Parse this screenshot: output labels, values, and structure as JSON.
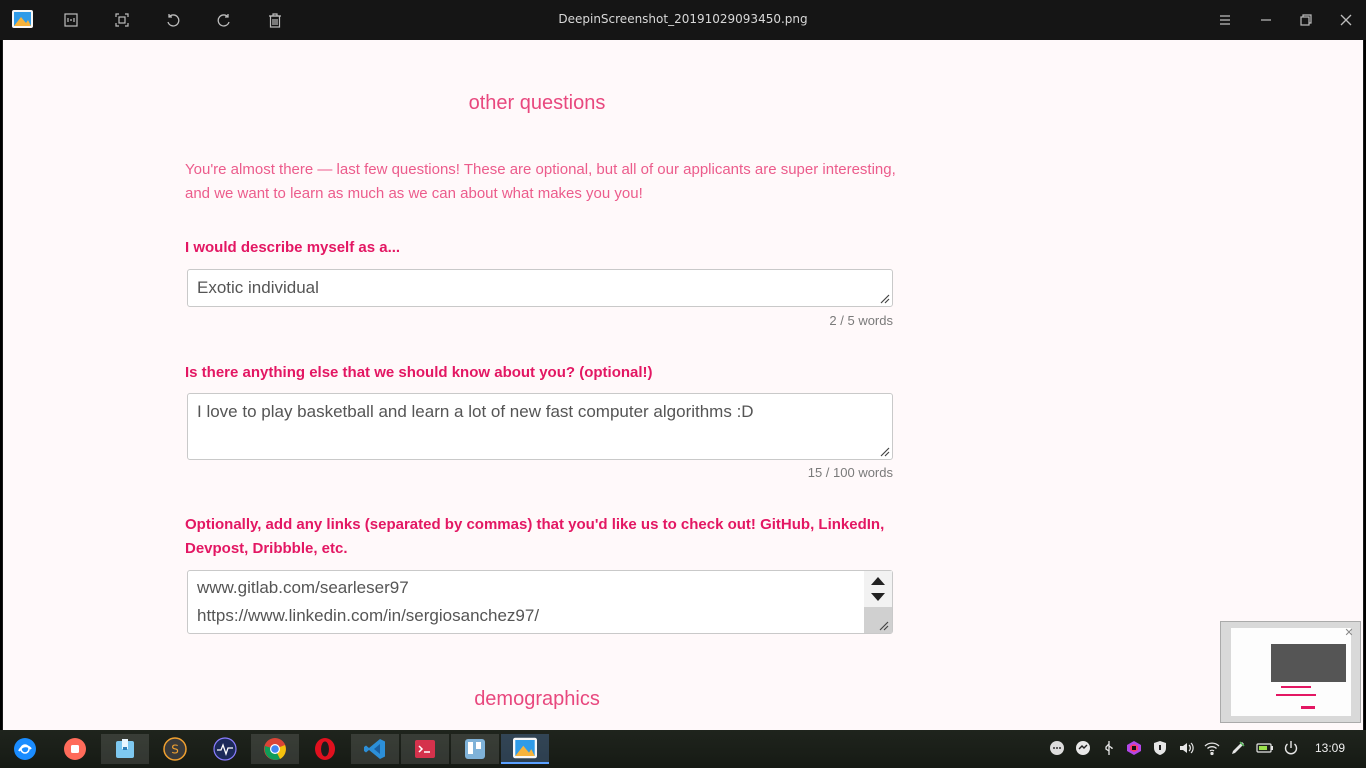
{
  "window": {
    "title": "DeepinScreenshot_20191029093450.png"
  },
  "form": {
    "section_title": "other questions",
    "intro": "You're almost there — last few questions! These are optional, but all of our applicants are super interesting, and we want to learn as much as we can about what makes you you!",
    "q1": {
      "label": "I would describe myself as a...",
      "value": "Exotic individual",
      "count": "2 / 5 words"
    },
    "q2": {
      "label": "Is there anything else that we should know about you? (optional!)",
      "value": "I love to play basketball and learn a lot of new fast computer algorithms :D",
      "count": "15 / 100 words"
    },
    "q3": {
      "label": "Optionally, add any links (separated by commas) that you'd like us to check out! GitHub, LinkedIn, Devpost, Dribbble, etc.",
      "line1": "www.gitlab.com/searleser97",
      "line2": "https://www.linkedin.com/in/sergiosanchez97/"
    },
    "next_section_title": "demographics"
  },
  "taskbar": {
    "apps": [
      "deepin-launcher",
      "screen-recorder",
      "file-manager",
      "sublime-text",
      "system-monitor",
      "chrome",
      "opera",
      "vscode",
      "terminal",
      "trello",
      "image-viewer"
    ],
    "clock": "13:09"
  },
  "colors": {
    "accent": "#e31763",
    "page_bg": "#fff9fa"
  }
}
